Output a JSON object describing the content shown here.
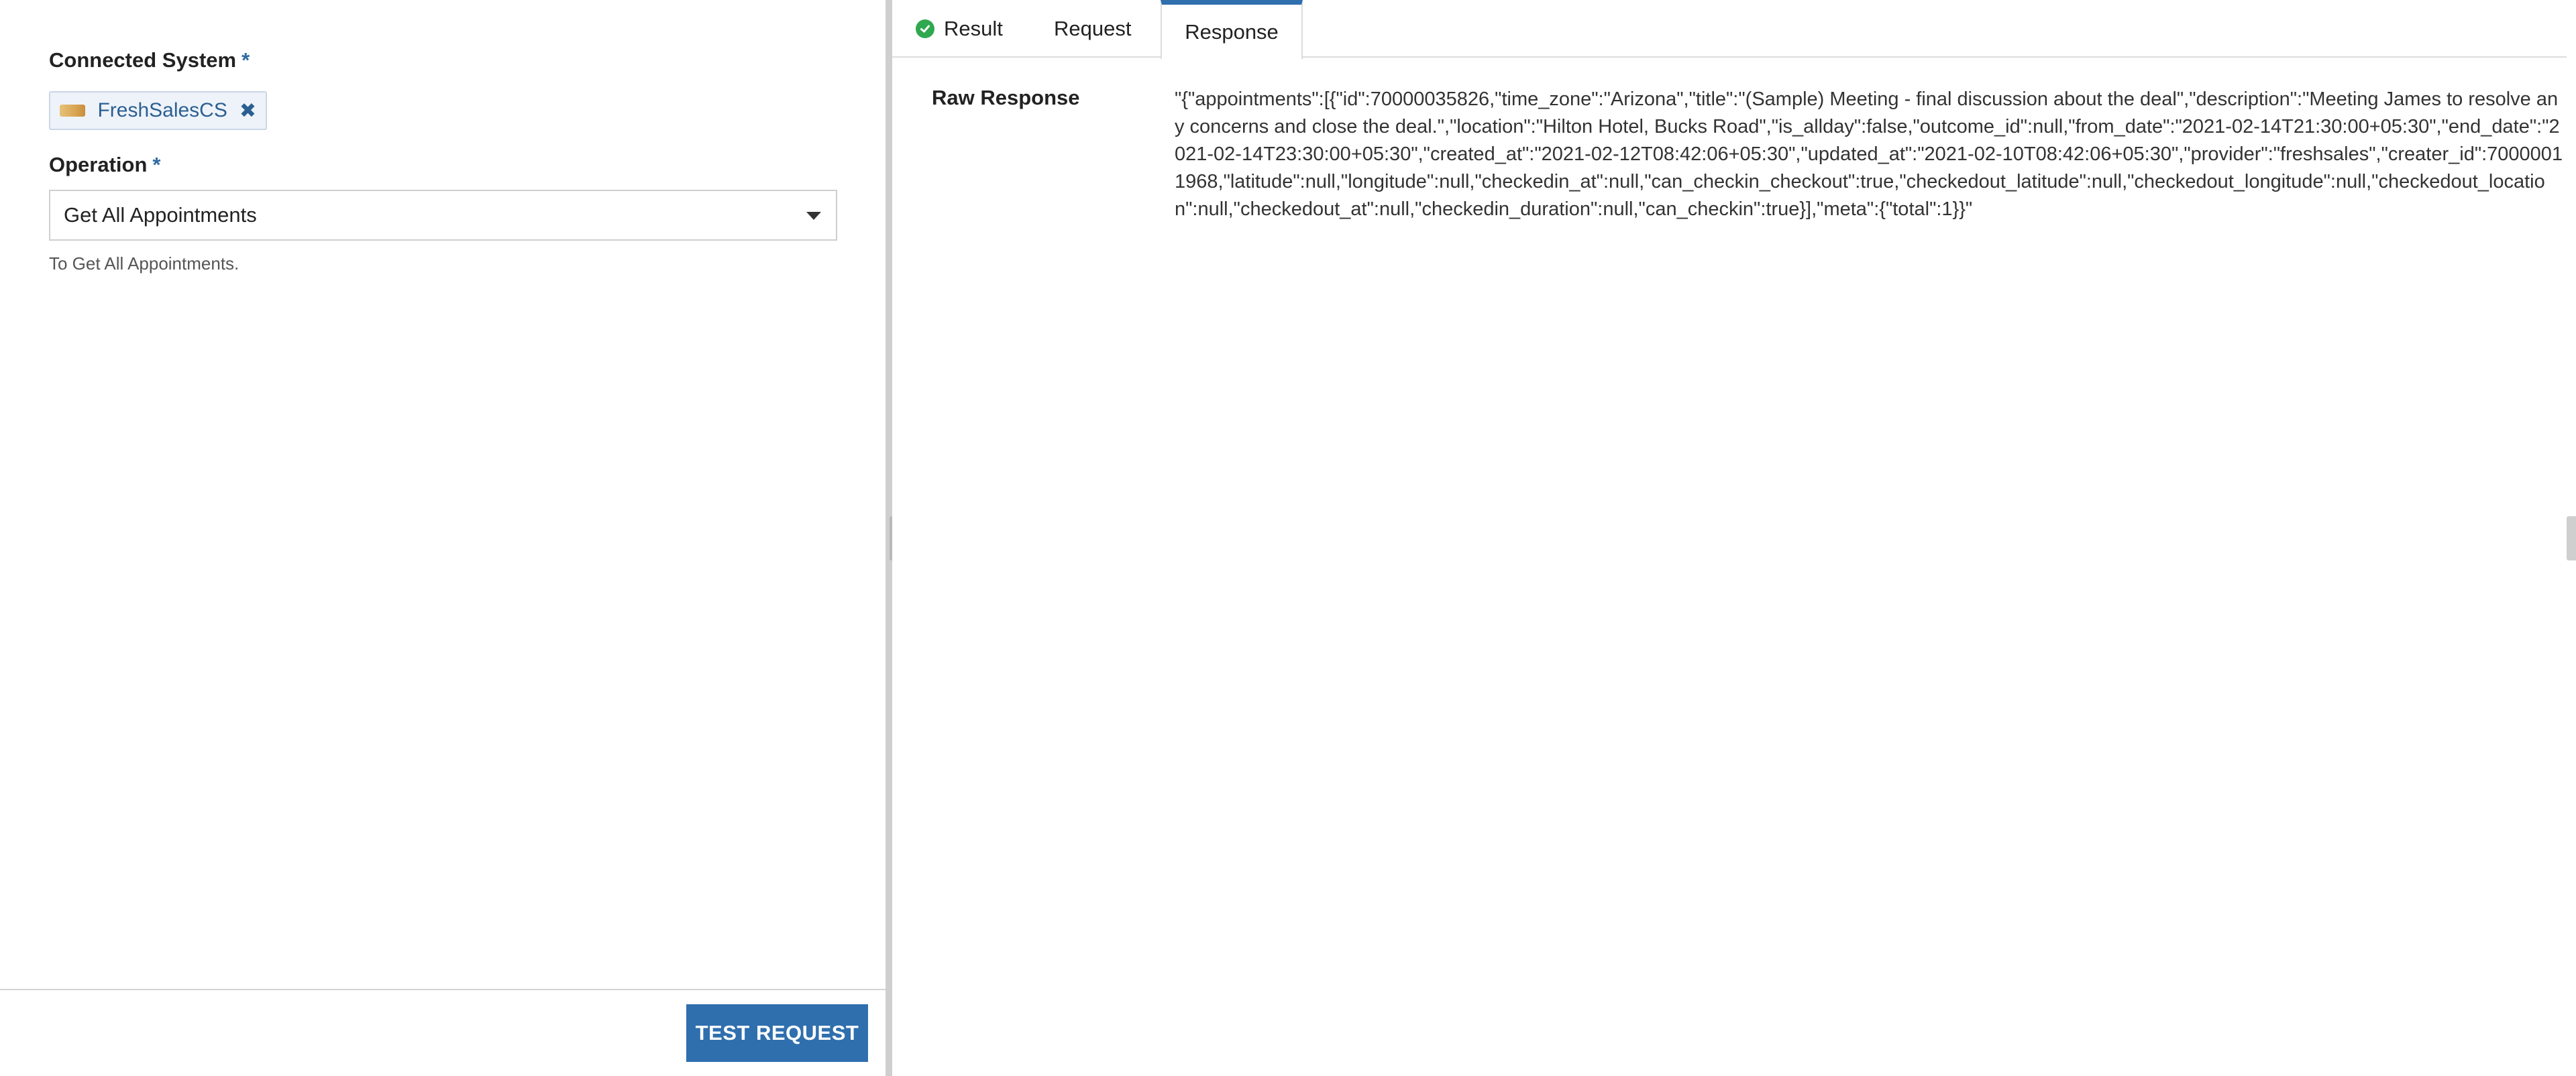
{
  "left": {
    "connected_system": {
      "label": "Connected System",
      "required_mark": "*",
      "chip_text": "FreshSalesCS",
      "chip_remove_glyph": "✖"
    },
    "operation": {
      "label": "Operation",
      "required_mark": "*",
      "selected": "Get All Appointments",
      "helper": "To Get All Appointments."
    },
    "test_button_label": "TEST REQUEST"
  },
  "right": {
    "tabs": [
      {
        "label": "Result",
        "icon": "check-circle-icon",
        "status_color": "#2fa84f"
      },
      {
        "label": "Request"
      },
      {
        "label": "Response",
        "active": true
      }
    ],
    "raw_response": {
      "label": "Raw Response",
      "value": "\"{\"appointments\":[{\"id\":70000035826,\"time_zone\":\"Arizona\",\"title\":\"(Sample) Meeting - final discussion about the deal\",\"description\":\"Meeting James to resolve any concerns and close the deal.\",\"location\":\"Hilton Hotel, Bucks Road\",\"is_allday\":false,\"outcome_id\":null,\"from_date\":\"2021-02-14T21:30:00+05:30\",\"end_date\":\"2021-02-14T23:30:00+05:30\",\"created_at\":\"2021-02-12T08:42:06+05:30\",\"updated_at\":\"2021-02-10T08:42:06+05:30\",\"provider\":\"freshsales\",\"creater_id\":70000011968,\"latitude\":null,\"longitude\":null,\"checkedin_at\":null,\"can_checkin_checkout\":true,\"checkedout_latitude\":null,\"checkedout_longitude\":null,\"checkedout_location\":null,\"checkedout_at\":null,\"checkedin_duration\":null,\"can_checkin\":true}],\"meta\":{\"total\":1}}\""
    }
  },
  "colors": {
    "accent": "#2f6fae",
    "chip_text": "#2b5f92",
    "success": "#2fa84f"
  }
}
